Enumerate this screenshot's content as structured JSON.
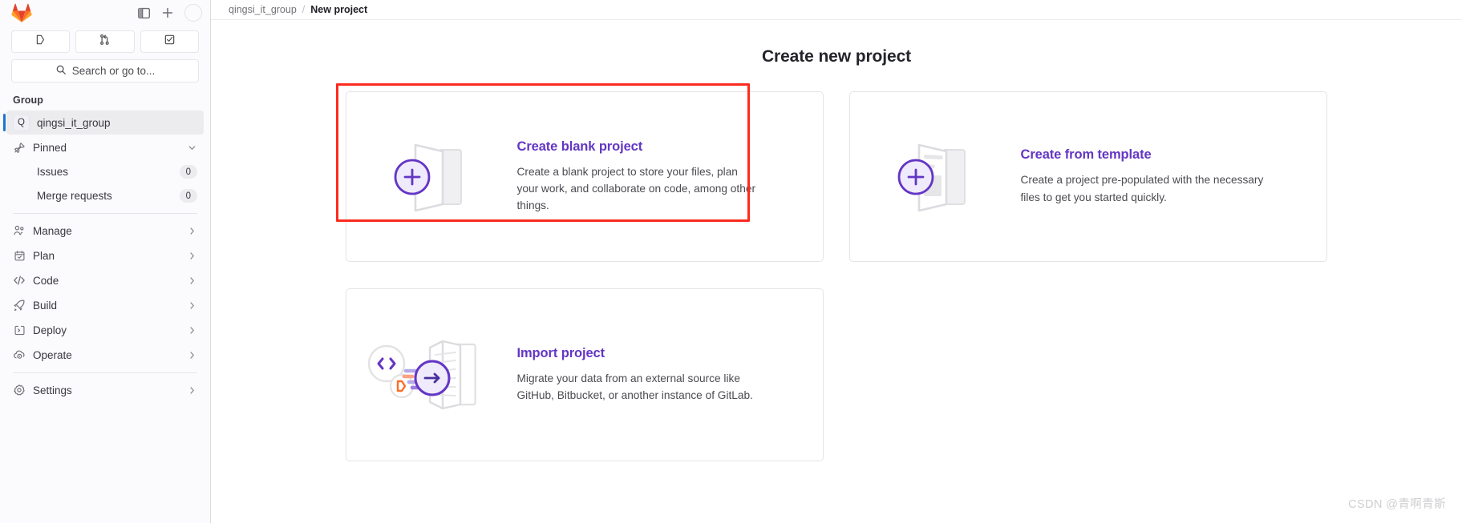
{
  "sidebar": {
    "header": {
      "logo_icon": "gitlab-logo-icon",
      "toggle_label": "",
      "toggle_icon": "sidebar-toggle-icon",
      "create_icon": "plus-icon",
      "avatar_icon": "user-avatar-icon"
    },
    "quick_actions": [
      {
        "name": "issues-shortcut",
        "icon": "issues-icon"
      },
      {
        "name": "merge-requests-shortcut",
        "icon": "merge-request-icon"
      },
      {
        "name": "todos-shortcut",
        "icon": "todo-check-icon"
      }
    ],
    "search": {
      "label": "Search or go to...",
      "icon": "search-icon"
    },
    "section_title": "Group",
    "group": {
      "avatar_initial": "Q",
      "name": "qingsi_it_group",
      "active": true
    },
    "pinned": {
      "label": "Pinned",
      "icon": "pin-icon",
      "chevron": "chevron-down-icon",
      "items": [
        {
          "label": "Issues",
          "count": "0"
        },
        {
          "label": "Merge requests",
          "count": "0"
        }
      ]
    },
    "nav_items": [
      {
        "label": "Manage",
        "icon": "users-icon"
      },
      {
        "label": "Plan",
        "icon": "calendar-icon"
      },
      {
        "label": "Code",
        "icon": "code-icon"
      },
      {
        "label": "Build",
        "icon": "rocket-icon"
      },
      {
        "label": "Deploy",
        "icon": "deploy-icon"
      },
      {
        "label": "Operate",
        "icon": "cloud-gear-icon"
      }
    ],
    "settings_item": {
      "label": "Settings",
      "icon": "gear-icon"
    }
  },
  "breadcrumb": {
    "group": "qingsi_it_group",
    "separator": "/",
    "current": "New project"
  },
  "page": {
    "title": "Create new project"
  },
  "cards": [
    {
      "id": "create-blank-project",
      "title": "Create blank project",
      "description": "Create a blank project to store your files, plan your work, and collaborate on code, among other things.",
      "icon": "blank-project-icon",
      "highlighted": true
    },
    {
      "id": "create-from-template",
      "title": "Create from template",
      "description": "Create a project pre-populated with the necessary files to get you started quickly.",
      "icon": "template-project-icon",
      "highlighted": false
    },
    {
      "id": "import-project",
      "title": "Import project",
      "description": "Migrate your data from an external source like GitHub, Bitbucket, or another instance of GitLab.",
      "icon": "import-project-icon",
      "highlighted": false
    }
  ],
  "watermark": "CSDN @青啊青斯",
  "colors": {
    "accent_purple": "#6336c4",
    "active_indicator": "#1f75cb",
    "annotation_red": "#fc2b1f",
    "sidebar_bg": "#fbfafd"
  }
}
